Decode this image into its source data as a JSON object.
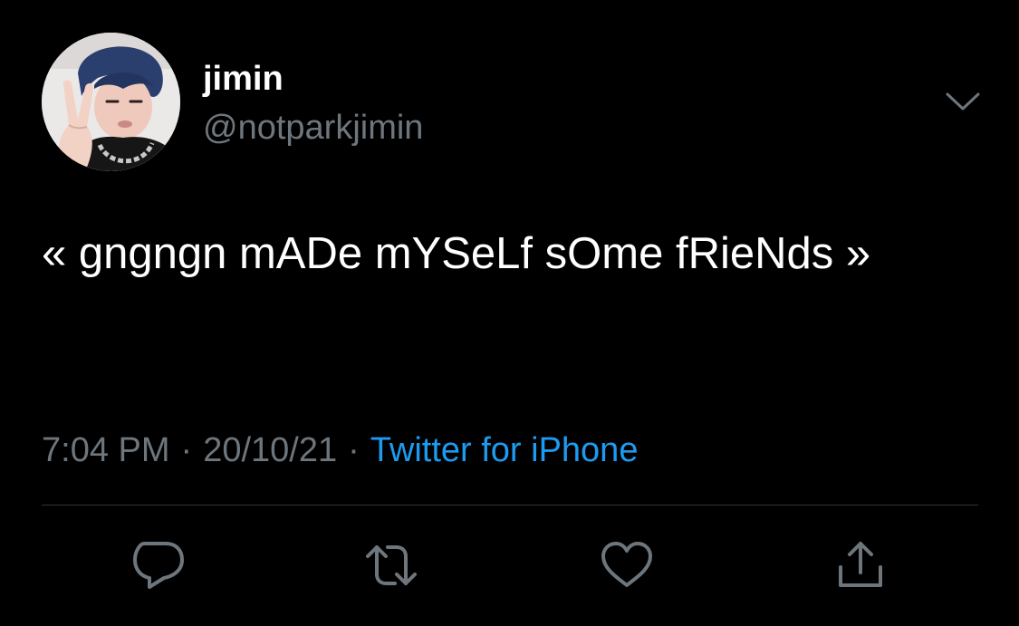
{
  "tweet": {
    "author": {
      "display_name": "jimin",
      "handle": "@notparkjimin",
      "avatar_icon": "profile-photo"
    },
    "text": "« gngngn mADe mYSeLf sOme fRieNds »",
    "time": "7:04 PM",
    "separator": "·",
    "date": "20/10/21",
    "source": "Twitter for iPhone"
  },
  "actions": [
    {
      "name": "reply",
      "icon": "speech-bubble-icon"
    },
    {
      "name": "retweet",
      "icon": "retweet-icon"
    },
    {
      "name": "like",
      "icon": "heart-icon"
    },
    {
      "name": "share",
      "icon": "share-icon"
    }
  ],
  "colors": {
    "background": "#000000",
    "text": "#ffffff",
    "secondary": "#6e767d",
    "link": "#1d9bf0",
    "divider": "#2f3336"
  }
}
